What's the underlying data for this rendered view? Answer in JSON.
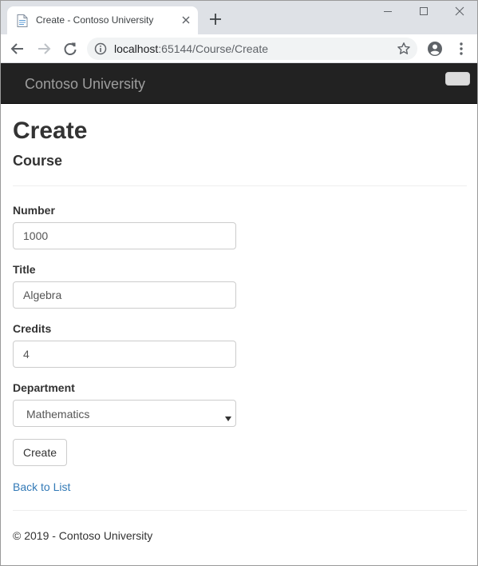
{
  "browser": {
    "tab_title": "Create - Contoso University",
    "url_host": "localhost",
    "url_rest": ":65144/Course/Create"
  },
  "site": {
    "brand": "Contoso University"
  },
  "page": {
    "title": "Create",
    "subtitle": "Course"
  },
  "form": {
    "number_label": "Number",
    "number_value": "1000",
    "title_label": "Title",
    "title_value": "Algebra",
    "credits_label": "Credits",
    "credits_value": "4",
    "department_label": "Department",
    "department_selected": "Mathematics",
    "submit_label": "Create"
  },
  "links": {
    "back": "Back to List"
  },
  "footer": {
    "text": "© 2019 - Contoso University"
  },
  "icons": {
    "favicon": "page-icon",
    "close": "close-icon",
    "new_tab": "plus-icon",
    "back": "arrow-left-icon",
    "forward": "arrow-right-icon",
    "reload": "reload-icon",
    "info": "info-icon",
    "bookmark": "star-icon",
    "profile": "account-icon",
    "menu": "kebab-menu-icon"
  },
  "colors": {
    "navbar": "#222222",
    "brand_text": "#9d9d9d",
    "link": "#337ab7"
  }
}
